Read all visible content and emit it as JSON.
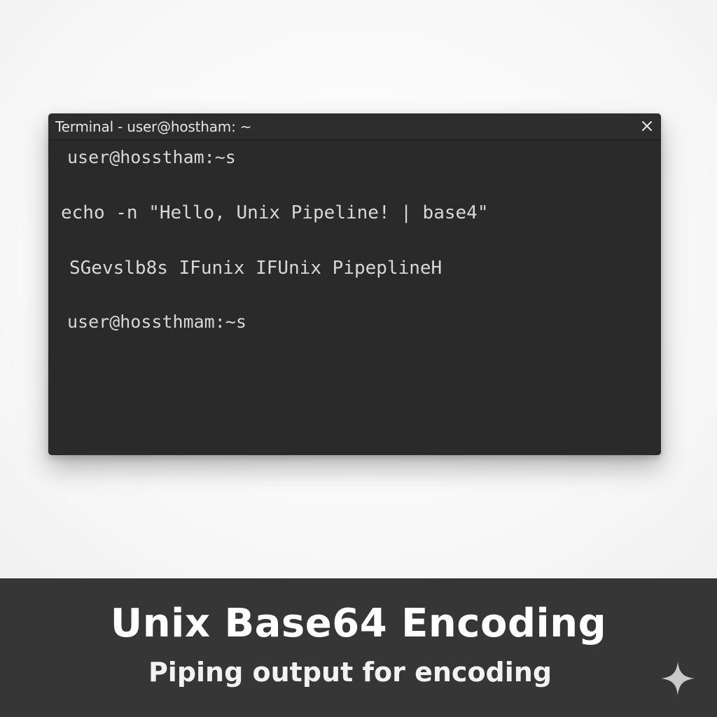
{
  "window": {
    "title": "Terminal - user@hostham: ~",
    "close_label": "×"
  },
  "terminal": {
    "lines": [
      "user@hosstham:~s",
      "echo -n \"Hello, Unix Pipeline! | base4\"",
      "SGevslb8s IFunix IFUnix PipeplineH",
      "user@hossthmam:~s"
    ],
    "background": "#2a2a2a",
    "text_color": "#d8d8d8"
  },
  "caption": {
    "title": "Unix Base64 Encoding",
    "subtitle": "Piping output for encoding",
    "background": "#363636"
  },
  "icons": {
    "close": "close-icon",
    "corner": "sparkle-icon"
  }
}
